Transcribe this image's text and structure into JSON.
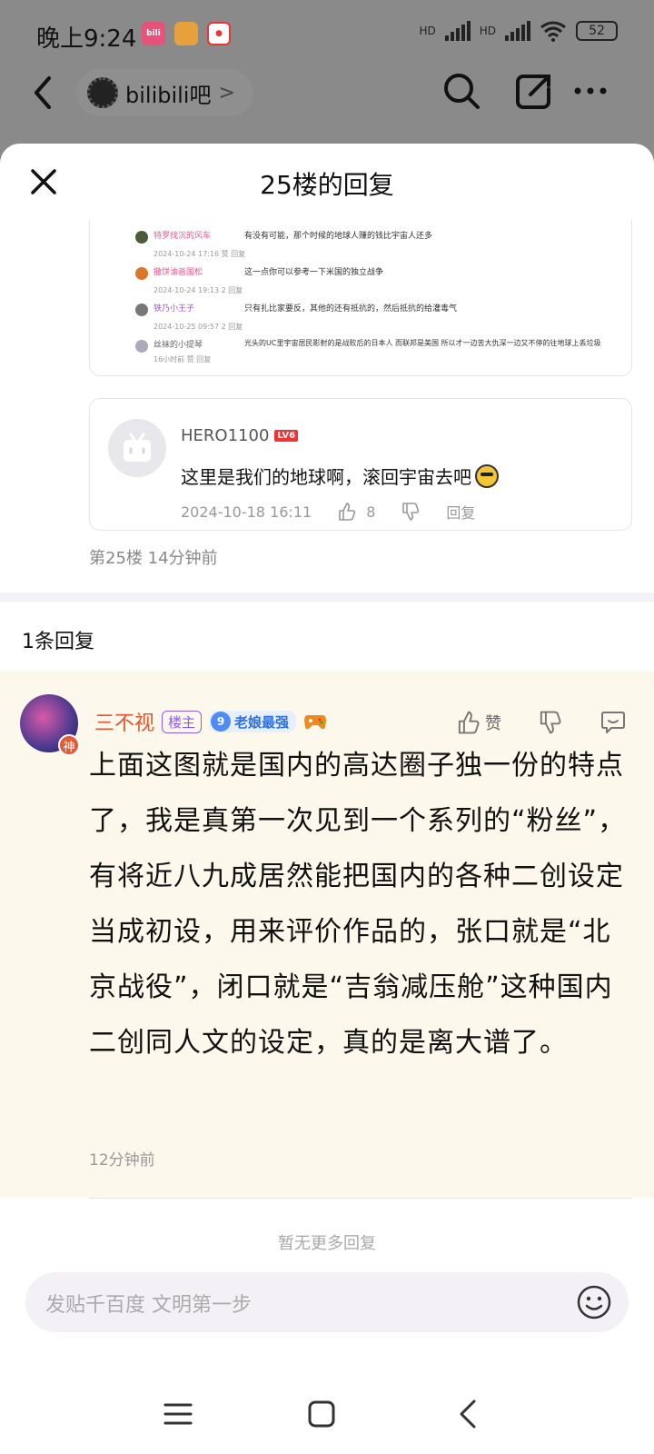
{
  "status_bar": {
    "time": "晚上9:24",
    "app_badges": [
      "bilibili",
      "folder",
      "notify"
    ],
    "network_1": "HD",
    "network_2": "HD",
    "battery": "52"
  },
  "top_nav": {
    "forum_name": "bilibili吧",
    "forum_arrow": ">"
  },
  "sheet": {
    "title": "25楼的回复",
    "image_rows": [
      {
        "name": "特罗找沉的风车",
        "text": "有没有可能，那个时候的地球人赚的钱比宇宙人还多",
        "meta": "2024-10-24 17:16  赞  回复",
        "color": "#e55a8a",
        "avatar": "#4a5a3a"
      },
      {
        "name": "撒饼油画国松",
        "text": "这一点你可以参考一下米国的独立战争",
        "meta": "2024-10-24 19:13  2  回复",
        "color": "#e55a8a",
        "avatar": "#d9782a"
      },
      {
        "name": "铁乃小王子",
        "text": "只有扎比家要反，其他的还有抵抗的，然后抵抗的给灌毒气",
        "meta": "2024-10-25 09:57  2  回复",
        "color": "#a354d6",
        "avatar": "#777"
      },
      {
        "name": "丝袜的小提琴",
        "text": "光头的UC里宇宙居民影射的是战败后的日本人 而联邦是美国 所以才一边苦大仇深一边又不停的往地球上丢垃圾",
        "meta": "16小时前  赞  回复",
        "color": "#666",
        "avatar": "#aab"
      }
    ],
    "quote": {
      "user": "HERO1100",
      "level": "LV6",
      "text": "这里是我们的地球啊，滚回宇宙去吧",
      "time": "2024-10-18 16:11",
      "likes": "8",
      "reply": "回复"
    },
    "floor_info": "第25楼  14分钟前",
    "reply_count": "1条回复",
    "reply": {
      "user": "三不视",
      "owner_tag": "楼主",
      "level": "9",
      "level_title": "老娘最强",
      "badge": "神",
      "like_label": "赞",
      "body": "上面这图就是国内的高达圈子独一份的特点了，我是真第一次见到一个系列的“粉丝”，有将近八九成居然能把国内的各种二创设定当成初设，用来评价作品的，张口就是“北京战役”，闭口就是“吉翁减压舱”这种国内二创同人文的设定，真的是离大谱了。",
      "time": "12分钟前"
    },
    "no_more": "暂无更多回复",
    "input_placeholder": "发贴千百度 文明第一步"
  }
}
